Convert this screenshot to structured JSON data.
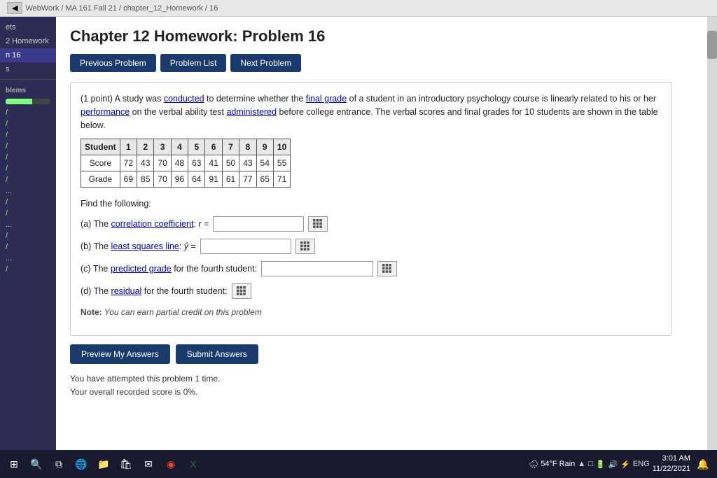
{
  "breadcrumb": {
    "back_label": "◀",
    "path": "WebWork / MA 161 Fall 21 / chapter_12_Homework / 16"
  },
  "sidebar": {
    "section_label": "2 Homework",
    "active_item": "n 16",
    "items": [
      {
        "label": "ets",
        "active": false
      },
      {
        "label": "2 Homework",
        "active": false
      },
      {
        "label": "n 16",
        "active": true
      },
      {
        "label": "s",
        "active": false
      }
    ],
    "problems_label": "blems",
    "check_items": [
      "/",
      "/",
      "/",
      "/",
      "/",
      "/",
      "/",
      "/",
      "/",
      "/",
      "/",
      "/"
    ],
    "dots_items": [
      "...",
      "...",
      "..."
    ]
  },
  "page": {
    "title": "Chapter 12 Homework: Problem 16",
    "nav_buttons": {
      "previous": "Previous Problem",
      "list": "Problem List",
      "next": "Next Problem"
    }
  },
  "problem": {
    "points": "(1 point)",
    "description": "A study was conducted to determine whether the final grade of a student in an introductory psychology course is linearly related to his or her performance on the verbal ability test administered before college entrance. The verbal scores and final grades for 10 students are shown in the table below.",
    "table": {
      "headers": [
        "Student",
        "1",
        "2",
        "3",
        "4",
        "5",
        "6",
        "7",
        "8",
        "9",
        "10"
      ],
      "score_row": [
        "Score",
        "72",
        "43",
        "70",
        "48",
        "63",
        "41",
        "50",
        "43",
        "54",
        "55"
      ],
      "grade_row": [
        "Grade",
        "69",
        "85",
        "70",
        "96",
        "64",
        "91",
        "61",
        "77",
        "65",
        "71"
      ]
    },
    "find_label": "Find the following:",
    "parts": {
      "a": {
        "label": "(a) The correlation coefficient: r =",
        "highlight": "correlation coefficient",
        "input_value": "",
        "placeholder": ""
      },
      "b": {
        "label": "(b) The least squares line: ŷ =",
        "highlight": "least squares line",
        "input_value": "",
        "placeholder": ""
      },
      "c": {
        "label": "(c) The predicted grade for the fourth student:",
        "highlight": "predicted grade",
        "input_value": "",
        "placeholder": ""
      },
      "d": {
        "label": "(d) The residual for the fourth student:",
        "highlight": "residual",
        "input_value": "",
        "placeholder": ""
      }
    },
    "note": {
      "label": "Note:",
      "text": "You can earn partial credit on this problem"
    },
    "buttons": {
      "preview": "Preview My Answers",
      "submit": "Submit Answers"
    },
    "attempt_info": {
      "line1": "You have attempted this problem 1 time.",
      "line2": "Your overall recorded score is 0%."
    }
  },
  "taskbar": {
    "weather": "54°F Rain",
    "language": "ENG",
    "time": "3:01 AM",
    "date": "11/22/2021"
  }
}
